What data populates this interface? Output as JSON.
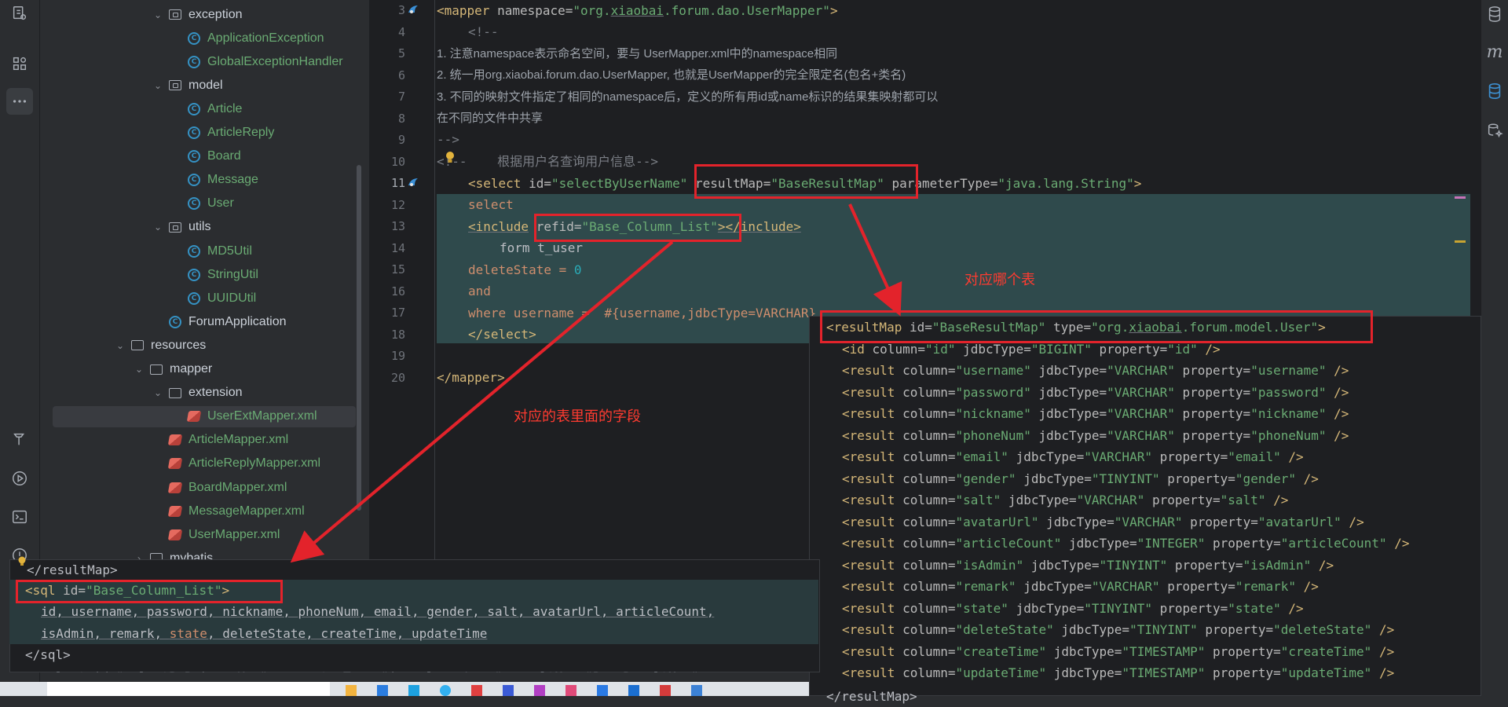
{
  "project_tree": [
    {
      "label": "exception",
      "kind": "package",
      "indent": 2,
      "expanded": true
    },
    {
      "label": "ApplicationException",
      "kind": "class",
      "indent": 3
    },
    {
      "label": "GlobalExceptionHandler",
      "kind": "class",
      "indent": 3
    },
    {
      "label": "model",
      "kind": "package",
      "indent": 2,
      "expanded": true
    },
    {
      "label": "Article",
      "kind": "class",
      "indent": 3
    },
    {
      "label": "ArticleReply",
      "kind": "class",
      "indent": 3
    },
    {
      "label": "Board",
      "kind": "class",
      "indent": 3
    },
    {
      "label": "Message",
      "kind": "class",
      "indent": 3
    },
    {
      "label": "User",
      "kind": "class",
      "indent": 3
    },
    {
      "label": "utils",
      "kind": "package",
      "indent": 2,
      "expanded": true
    },
    {
      "label": "MD5Util",
      "kind": "class",
      "indent": 3
    },
    {
      "label": "StringUtil",
      "kind": "class",
      "indent": 3
    },
    {
      "label": "UUIDUtil",
      "kind": "class",
      "indent": 3
    },
    {
      "label": "ForumApplication",
      "kind": "app",
      "indent": 2
    },
    {
      "label": "resources",
      "kind": "folder",
      "indent": 0,
      "expanded": true
    },
    {
      "label": "mapper",
      "kind": "folder",
      "indent": 1,
      "expanded": true
    },
    {
      "label": "extension",
      "kind": "folder",
      "indent": 2,
      "expanded": true
    },
    {
      "label": "UserExtMapper.xml",
      "kind": "xml",
      "indent": 3,
      "selected": true
    },
    {
      "label": "ArticleMapper.xml",
      "kind": "xml",
      "indent": 2
    },
    {
      "label": "ArticleReplyMapper.xml",
      "kind": "xml",
      "indent": 2
    },
    {
      "label": "BoardMapper.xml",
      "kind": "xml",
      "indent": 2
    },
    {
      "label": "MessageMapper.xml",
      "kind": "xml",
      "indent": 2
    },
    {
      "label": "UserMapper.xml",
      "kind": "xml",
      "indent": 2
    },
    {
      "label": "mybatis",
      "kind": "folder",
      "indent": 1,
      "expanded": false
    }
  ],
  "editor": {
    "line_numbers": [
      "3",
      "4",
      "5",
      "6",
      "7",
      "8",
      "9",
      "10",
      "11",
      "12",
      "13",
      "14",
      "15",
      "16",
      "17",
      "18",
      "19",
      "20"
    ],
    "current_line": "11",
    "mapper_open": {
      "tag": "<mapper",
      "attr": " namespace=",
      "value_pre": "\"org.",
      "value_ul": "xiaobai",
      "value_post": ".forum.dao.UserMapper\"",
      "close": ">"
    },
    "comment_open": "<!--",
    "comment_lines": [
      "1. 注意namespace表示命名空间，要与 UserMapper.xml中的namespace相同",
      "2. 统一用org.xiaobai.forum.dao.UserMapper, 也就是UserMapper的完全限定名(包名+类名)",
      "3. 不同的映射文件指定了相同的namespace后，定义的所有用id或name标识的结果集映射都可以",
      "在不同的文件中共享"
    ],
    "comment_close": "-->",
    "query_comment": "<!--    根据用户名查询用户信息-->",
    "select_tag": "<select",
    "select_id_attr": " id=",
    "select_id_val": "\"selectByUserName\"",
    "select_rm_attr": " resultMap=",
    "select_rm_val": "\"BaseResultMap\"",
    "select_pt_attr": " parameterType=",
    "select_pt_val": "\"java.lang.String\"",
    "select_close": ">",
    "kw_select": "select",
    "include_open": "<include",
    "include_attr": " refid=",
    "include_val": "\"Base_Column_List\"",
    "include_close": "></include>",
    "from_line": "form t_user",
    "delete_col": "deleteState = ",
    "delete_val": "0",
    "and_kw": "and",
    "where_line": "where username =  #{username,jdbcType=VARCHAR}",
    "select_end": "</select>",
    "mapper_close": "</mapper>"
  },
  "resultmap_popup": {
    "header_tag": "<resultMap",
    "header_id_attr": " id=",
    "header_id_val": "\"BaseResultMap\"",
    "header_type_attr": " type=",
    "header_type_pre": "\"org.",
    "header_type_ul": "xiaobai",
    "header_type_post": ".forum.model.User\"",
    "header_close": ">",
    "id_row": {
      "tag": "<id",
      "column": "\"id\"",
      "jdbcType": "\"BIGINT\"",
      "property": "\"id\""
    },
    "rows": [
      {
        "column": "\"username\"",
        "jdbcType": "\"VARCHAR\"",
        "property": "\"username\""
      },
      {
        "column": "\"password\"",
        "jdbcType": "\"VARCHAR\"",
        "property": "\"password\""
      },
      {
        "column": "\"nickname\"",
        "jdbcType": "\"VARCHAR\"",
        "property": "\"nickname\""
      },
      {
        "column": "\"phoneNum\"",
        "jdbcType": "\"VARCHAR\"",
        "property": "\"phoneNum\""
      },
      {
        "column": "\"email\"",
        "jdbcType": "\"VARCHAR\"",
        "property": "\"email\""
      },
      {
        "column": "\"gender\"",
        "jdbcType": "\"TINYINT\"",
        "property": "\"gender\""
      },
      {
        "column": "\"salt\"",
        "jdbcType": "\"VARCHAR\"",
        "property": "\"salt\""
      },
      {
        "column": "\"avatarUrl\"",
        "jdbcType": "\"VARCHAR\"",
        "property": "\"avatarUrl\""
      },
      {
        "column": "\"articleCount\"",
        "jdbcType": "\"INTEGER\"",
        "property": "\"articleCount\""
      },
      {
        "column": "\"isAdmin\"",
        "jdbcType": "\"TINYINT\"",
        "property": "\"isAdmin\""
      },
      {
        "column": "\"remark\"",
        "jdbcType": "\"VARCHAR\"",
        "property": "\"remark\""
      },
      {
        "column": "\"state\"",
        "jdbcType": "\"TINYINT\"",
        "property": "\"state\""
      },
      {
        "column": "\"deleteState\"",
        "jdbcType": "\"TINYINT\"",
        "property": "\"deleteState\""
      },
      {
        "column": "\"createTime\"",
        "jdbcType": "\"TIMESTAMP\"",
        "property": "\"createTime\""
      },
      {
        "column": "\"updateTime\"",
        "jdbcType": "\"TIMESTAMP\"",
        "property": "\"updateTime\""
      }
    ],
    "footer": "</resultMap>"
  },
  "sql_popup": {
    "prev_close": "</resultMap>",
    "sql_tag": "<sql",
    "sql_id_attr": " id=",
    "sql_id_val": "\"Base_Column_List\"",
    "sql_close": ">",
    "cols_line1": "id, username, password, nickname, phoneNum, email, gender, salt, avatarUrl, articleCount,",
    "cols_line2_pre": "isAdmin, remark, ",
    "cols_line2_state": "state",
    "cols_line2_post": ", deleteState, createTime, updateTime",
    "sql_end": "</sql>",
    "ghost_line": "<select id=\"selectByPrimaryKey\" parameterType=\"java.lang.Long\" resultMap=\"BaseResultMap\">"
  },
  "annotations": {
    "table_label": "对应哪个表",
    "fields_label": "对应的表里面的字段"
  },
  "colors": {
    "annotation_red": "#e3232b",
    "tag_yellow": "#d5b778",
    "string_green": "#6aab73",
    "number_cyan": "#2aacb8",
    "highlight_teal": "#2f4a4c"
  }
}
